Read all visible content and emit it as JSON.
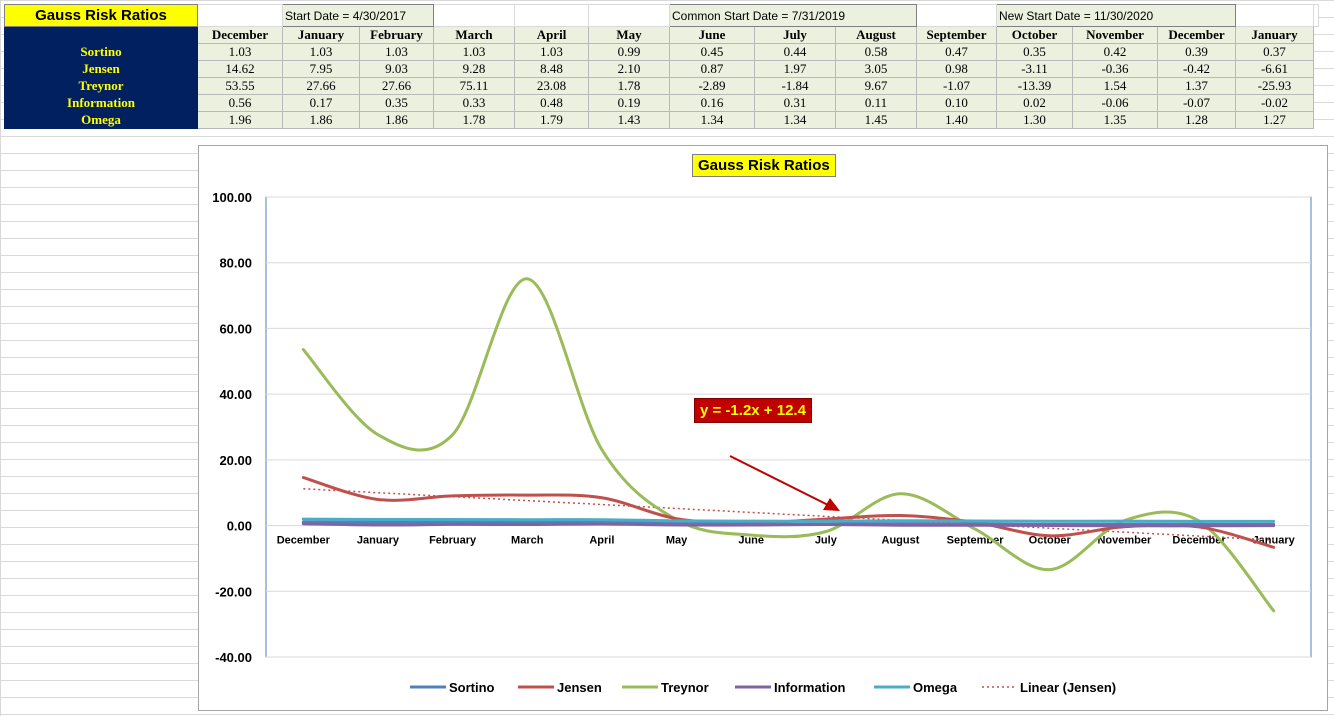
{
  "sheet": {
    "title": "Gauss Risk Ratios",
    "date_labels": [
      "Start Date = 4/30/2017",
      "Common Start Date = 7/31/2019",
      "New Start Date = 11/30/2020"
    ],
    "months": [
      "December",
      "January",
      "February",
      "March",
      "April",
      "May",
      "June",
      "July",
      "August",
      "September",
      "October",
      "November",
      "December",
      "January"
    ],
    "rows": [
      {
        "label": "Sortino",
        "values": [
          "1.03",
          "1.03",
          "1.03",
          "1.03",
          "1.03",
          "0.99",
          "0.45",
          "0.44",
          "0.58",
          "0.47",
          "0.35",
          "0.42",
          "0.39",
          "0.37"
        ]
      },
      {
        "label": "Jensen",
        "values": [
          "14.62",
          "7.95",
          "9.03",
          "9.28",
          "8.48",
          "2.10",
          "0.87",
          "1.97",
          "3.05",
          "0.98",
          "-3.11",
          "-0.36",
          "-0.42",
          "-6.61"
        ]
      },
      {
        "label": "Treynor",
        "values": [
          "53.55",
          "27.66",
          "27.66",
          "75.11",
          "23.08",
          "1.78",
          "-2.89",
          "-1.84",
          "9.67",
          "-1.07",
          "-13.39",
          "1.54",
          "1.37",
          "-25.93"
        ]
      },
      {
        "label": "Information",
        "values": [
          "0.56",
          "0.17",
          "0.35",
          "0.33",
          "0.48",
          "0.19",
          "0.16",
          "0.31",
          "0.11",
          "0.10",
          "0.02",
          "-0.06",
          "-0.07",
          "-0.02"
        ]
      },
      {
        "label": "Omega",
        "values": [
          "1.96",
          "1.86",
          "1.86",
          "1.78",
          "1.79",
          "1.43",
          "1.34",
          "1.34",
          "1.45",
          "1.40",
          "1.30",
          "1.35",
          "1.28",
          "1.27"
        ]
      }
    ]
  },
  "chart_data": {
    "type": "line",
    "title": "Gauss Risk Ratios",
    "categories": [
      "December",
      "January",
      "February",
      "March",
      "April",
      "May",
      "June",
      "July",
      "August",
      "September",
      "October",
      "November",
      "December",
      "January"
    ],
    "ylim": [
      -40,
      100
    ],
    "yticks": [
      "100.00",
      "80.00",
      "60.00",
      "40.00",
      "20.00",
      "0.00",
      "-20.00",
      "-40.00"
    ],
    "ytick_values": [
      100,
      80,
      60,
      40,
      20,
      0,
      -20,
      -40
    ],
    "grid": true,
    "legend_position": "bottom",
    "series": [
      {
        "name": "Sortino",
        "color": "#4f81bd",
        "values": [
          1.03,
          1.03,
          1.03,
          1.03,
          1.03,
          0.99,
          0.45,
          0.44,
          0.58,
          0.47,
          0.35,
          0.42,
          0.39,
          0.37
        ]
      },
      {
        "name": "Jensen",
        "color": "#c0504d",
        "values": [
          14.62,
          7.95,
          9.03,
          9.28,
          8.48,
          2.1,
          0.87,
          1.97,
          3.05,
          0.98,
          -3.11,
          -0.36,
          -0.42,
          -6.61
        ]
      },
      {
        "name": "Treynor",
        "color": "#9bbb59",
        "values": [
          53.55,
          27.66,
          27.66,
          75.11,
          23.08,
          1.78,
          -2.89,
          -1.84,
          9.67,
          -1.07,
          -13.39,
          1.54,
          1.37,
          -25.93
        ]
      },
      {
        "name": "Information",
        "color": "#8064a2",
        "values": [
          0.56,
          0.17,
          0.35,
          0.33,
          0.48,
          0.19,
          0.16,
          0.31,
          0.11,
          0.1,
          0.02,
          -0.06,
          -0.07,
          -0.02
        ]
      },
      {
        "name": "Omega",
        "color": "#4bacc6",
        "values": [
          1.96,
          1.86,
          1.86,
          1.78,
          1.79,
          1.43,
          1.34,
          1.34,
          1.45,
          1.4,
          1.3,
          1.35,
          1.28,
          1.27
        ]
      }
    ],
    "trendline": {
      "name": "Linear (Jensen)",
      "color": "#c0504d",
      "slope": -1.2,
      "intercept": 12.4
    },
    "annotation": "y = -1.2x + 12.4"
  }
}
